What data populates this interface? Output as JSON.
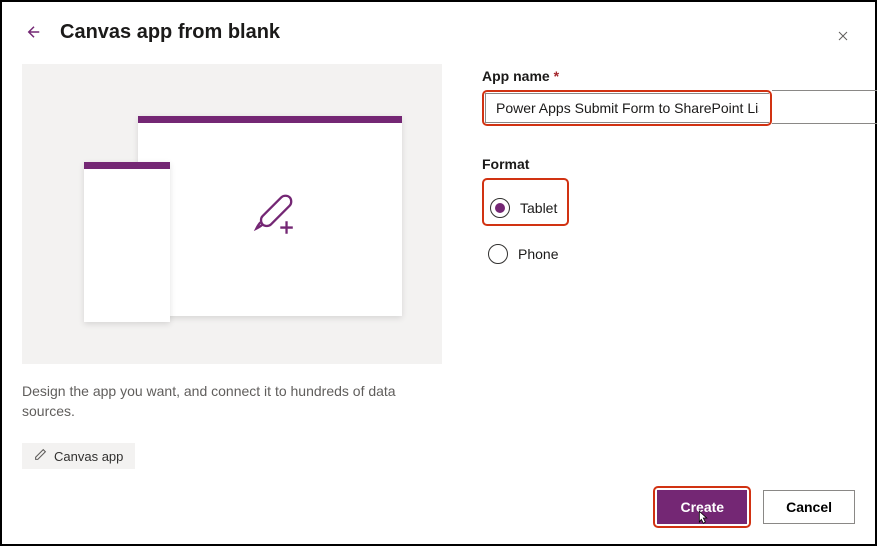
{
  "header": {
    "title": "Canvas app from blank"
  },
  "left": {
    "description": "Design the app you want, and connect it to hundreds of data sources.",
    "tag": "Canvas app"
  },
  "form": {
    "appNameLabel": "App name",
    "appNameValue": "Power Apps Submit Form to SharePoint List",
    "formatLabel": "Format",
    "options": {
      "tablet": "Tablet",
      "phone": "Phone"
    }
  },
  "footer": {
    "create": "Create",
    "cancel": "Cancel"
  }
}
